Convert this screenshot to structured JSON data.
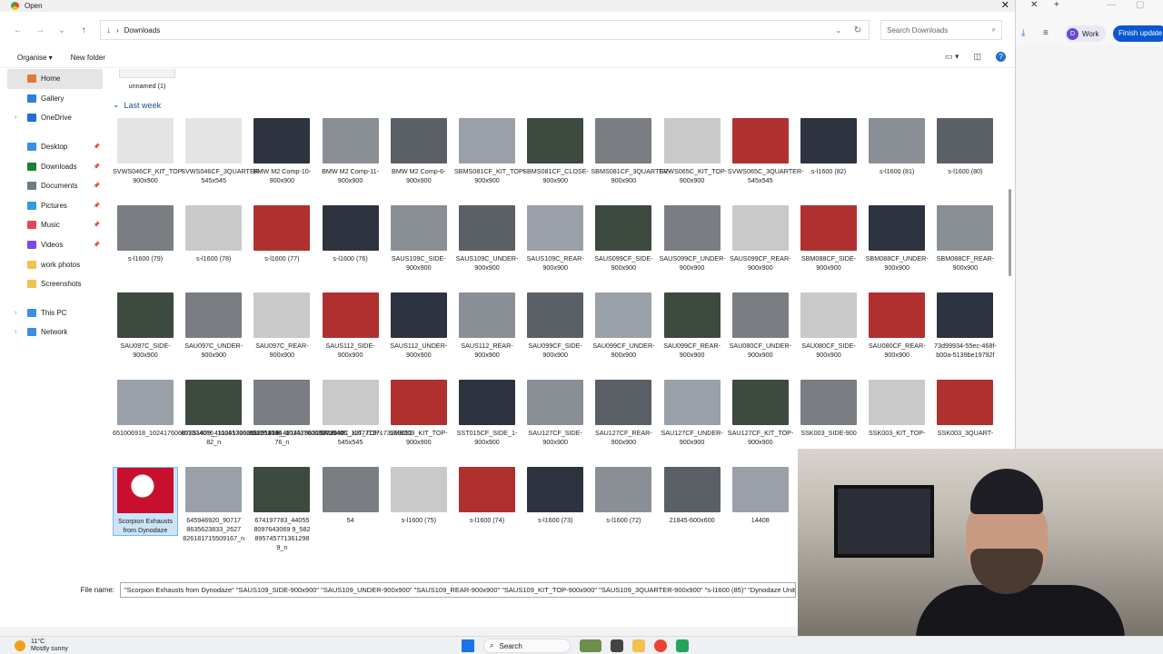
{
  "window": {
    "title": "Open",
    "close_glyph": "✕"
  },
  "address": {
    "path": "Downloads",
    "search_placeholder": "Search Downloads"
  },
  "commands": {
    "organise": "Organise ▾",
    "new_folder": "New folder"
  },
  "sidebar": {
    "items": [
      {
        "label": "Home",
        "icon": "home-icon",
        "color": "#e07a3a",
        "selected": true
      },
      {
        "label": "Gallery",
        "icon": "gallery-icon",
        "color": "#2f7ed8"
      },
      {
        "label": "OneDrive",
        "icon": "cloud-icon",
        "color": "#1f6fd1",
        "expand": true
      },
      {
        "label": "Desktop",
        "icon": "desktop-icon",
        "color": "#3a8ee6",
        "pinned": true
      },
      {
        "label": "Downloads",
        "icon": "download-icon",
        "color": "#1a7f37",
        "pinned": true
      },
      {
        "label": "Documents",
        "icon": "documents-icon",
        "color": "#6d7a8a",
        "pinned": true
      },
      {
        "label": "Pictures",
        "icon": "pictures-icon",
        "color": "#2f9be0",
        "pinned": true
      },
      {
        "label": "Music",
        "icon": "music-icon",
        "color": "#e0495c",
        "pinned": true
      },
      {
        "label": "Videos",
        "icon": "videos-icon",
        "color": "#7a4de0",
        "pinned": true
      },
      {
        "label": "work photos",
        "icon": "folder-icon",
        "color": "#f2c14e"
      },
      {
        "label": "Screenshots",
        "icon": "folder-icon",
        "color": "#f2c14e"
      },
      {
        "label": "This PC",
        "icon": "pc-icon",
        "color": "#3a8ee6",
        "expand": true
      },
      {
        "label": "Network",
        "icon": "network-icon",
        "color": "#3a8ee6",
        "expand": true
      }
    ]
  },
  "group_label": "Last week",
  "top_file": "unnamed (1)",
  "files": [
    [
      "SVWS046CF_KIT_TOP-900x900",
      "SVWS046CF_3QUARTER-545x545",
      "BMW M2 Comp-10-900x900",
      "BMW M2 Comp-11-900x900",
      "BMW M2 Comp-6-900x900",
      "SBMS081CF_KIT_TOP-900x900",
      "SBMS081CF_CLOSE-900x900",
      "SBMS081CF_3QUARTER-900x900",
      "SVWS065C_KIT_TOP-900x900",
      "SVWS065C_3QUARTER-545x545",
      "s-l1600 (82)",
      "s-l1600 (81)",
      "s-l1600 (80)"
    ],
    [
      "s-l1600 (79)",
      "s-l1600 (78)",
      "s-l1600 (77)",
      "s-l1600 (76)",
      "SAUS109C_SIDE-900x900",
      "SAUS109C_UNDER-900x900",
      "SAUS109C_REAR-900x900",
      "SAUS099CF_SIDE-900x900",
      "SAUS099CF_UNDER-900x900",
      "SAUS099CF_REAR-900x900",
      "SBM088CF_SIDE-900x900",
      "SBM088CF_UNDER-900x900",
      "SBM088CF_REAR-900x900"
    ],
    [
      "SAU097C_SIDE-900x900",
      "SAU097C_UNDER-900x900",
      "SAU097C_REAR-900x900",
      "SAUS112_SIDE-900x900",
      "SAUS112_UNDER-900x900",
      "SAUS112_REAR-900x900",
      "SAU099CF_SIDE-900x900",
      "SAU099CF_UNDER-900x900",
      "SAU099CF_REAR-900x900",
      "SAU080CF_UNDER-900x900",
      "SAU080CF_SIDE-900x900",
      "SAU080CF_REAR-900x900",
      "73d99934-55ec-468f-b00a-5139be19792f"
    ],
    [
      "651006918_10241760687851409_4110653262118911745_n",
      "651334076_10241760688251419_42145286323928932 82_n",
      "651259094_10241760687731406_11677127173269053 76_n",
      "SAU044C_KIT_TOP-545x545",
      "SMB003_KIT_TOP-900x900",
      "SST015CF_SIDE_1-900x900",
      "SAU127CF_SIDE-900x900",
      "SAU127CF_REAR-900x900",
      "SAU127CF_UNDER-900x900",
      "SAU127CF_KIT_TOP-900x900",
      "SSK003_SIDE-900",
      "SSK003_KIT_TOP-",
      "SSK003_3QUART-"
    ],
    [
      "Scorpion Exhausts from Dynodaze",
      "645946920_90717 8635623833_2627 826181715509167_n",
      "674197783_44055 8097643069 9_582 895745771361298 9_n",
      "54",
      "s-l1600 (75)",
      "s-l1600 (74)",
      "s-l1600 (73)",
      "s-l1600 (72)",
      "21845-600x600",
      "14408"
    ]
  ],
  "filename": {
    "label": "File name:",
    "value": "\"Scorpion Exhausts from Dynodaze\" \"SAUS109_SIDE-900x900\" \"SAUS109_UNDER-900x900\" \"SAUS109_REAR-900x900\" \"SAUS109_KIT_TOP-900x900\" \"SAUS109_3QUARTER-900x900\" \"s-l1600 (85)\" \"Dynodaze Unit"
  },
  "browser": {
    "work_label": "Work",
    "avatar_letter": "D",
    "finish_label": "Finish update"
  },
  "taskbar": {
    "temp": "11°C",
    "condition": "Mostly sunny",
    "search_label": "Search"
  }
}
